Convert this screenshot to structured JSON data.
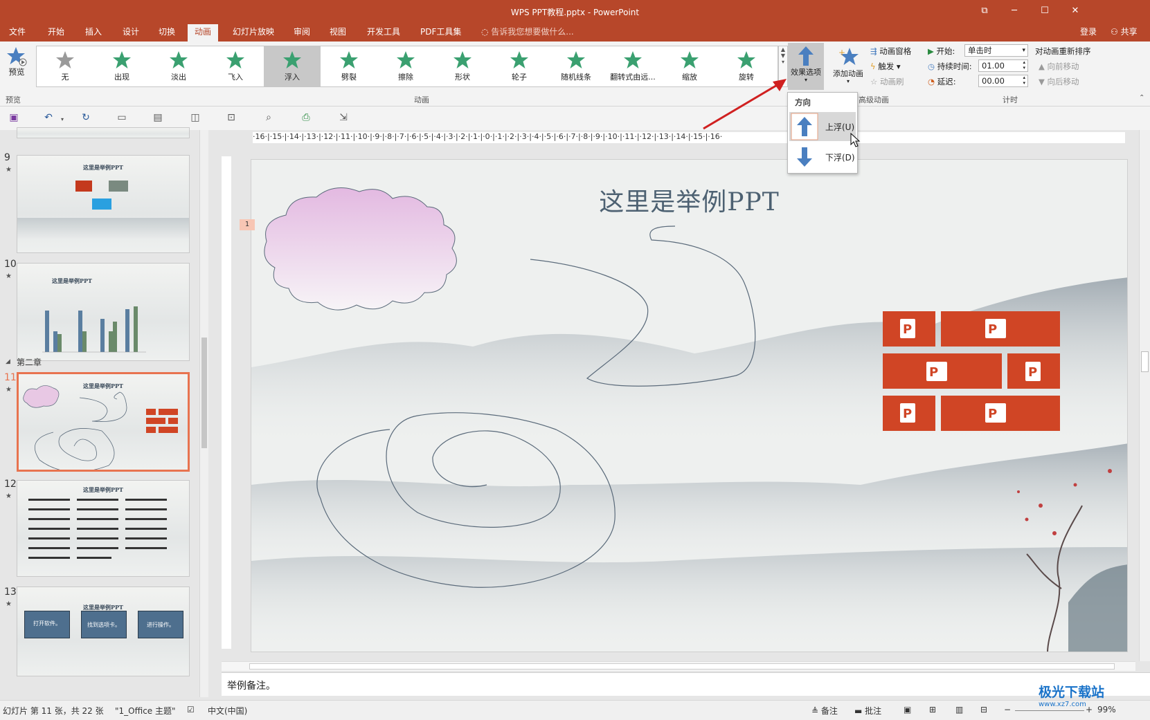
{
  "window": {
    "title": "WPS PPT教程.pptx - PowerPoint",
    "restore_icon": "ribbon-display-icon",
    "minimize": "─",
    "maximize": "☐",
    "close": "✕"
  },
  "menu": {
    "tabs": [
      "文件",
      "开始",
      "插入",
      "设计",
      "切换",
      "动画",
      "幻灯片放映",
      "审阅",
      "视图",
      "开发工具",
      "PDF工具集"
    ],
    "active_tab": "动画",
    "tell_me": "告诉我您想要做什么...",
    "login": "登录",
    "share": "共享"
  },
  "ribbon": {
    "preview_label": "预览",
    "preview_group": "预览",
    "animation_group": "动画",
    "advanced_group": "高级动画",
    "timing_group": "计时",
    "gallery": [
      "无",
      "出现",
      "淡出",
      "飞入",
      "浮入",
      "劈裂",
      "擦除",
      "形状",
      "轮子",
      "随机线条",
      "翻转式由远...",
      "缩放",
      "旋转"
    ],
    "gallery_selected": "浮入",
    "effect_options": "效果选项",
    "add_animation": "添加动画",
    "animation_pane": "动画窗格",
    "trigger": "触发",
    "animation_painter": "动画刷",
    "start_label": "开始:",
    "start_value": "单击时",
    "duration_label": "持续时间:",
    "duration_value": "01.00",
    "delay_label": "延迟:",
    "delay_value": "00.00",
    "reorder_label": "对动画重新排序",
    "move_earlier": "向前移动",
    "move_later": "向后移动"
  },
  "dropdown": {
    "header": "方向",
    "items": [
      "上浮(U)",
      "下浮(D)"
    ],
    "hovered": "上浮(U)"
  },
  "thumbnails": {
    "section_label": "第二章",
    "slides": [
      {
        "num": "9",
        "title": "这里是举例PPT"
      },
      {
        "num": "10",
        "title": "这里是举例PPT"
      },
      {
        "num": "11",
        "title": "这里是举例PPT"
      },
      {
        "num": "12",
        "title": "这里是举例PPT"
      },
      {
        "num": "13",
        "title": "这里是举例PPT"
      }
    ],
    "slide13_boxes": [
      "打开软件。",
      "找到选项卡。",
      "进行操作。"
    ],
    "star": "★"
  },
  "slide": {
    "title": "这里是举例PPT",
    "animation_tag": "1",
    "ruler_h": "·16·|·15·|·14·|·13·|·12·|·11·|·10·|·9·|·8·|·7·|·6·|·5·|·4·|·3·|·2·|·1·|·0·|·1·|·2·|·3·|·4·|·5·|·6·|·7·|·8·|·9·|·10·|·11·|·12·|·13·|·14·|·15·|·16·"
  },
  "notes": {
    "text": "举例备注。"
  },
  "status": {
    "slide_info": "幻灯片 第 11 张，共 22 张",
    "theme": "\"1_Office 主题\"",
    "language": "中文(中国)",
    "notes_btn": "备注",
    "comments_btn": "批注",
    "zoom": "99%"
  },
  "watermark": {
    "text": "极光下载站",
    "sub": "www.xz7.com"
  },
  "colors": {
    "accent": "#b7472a",
    "ppt_tile": "#d04525",
    "selected_tile": "#e8734f"
  }
}
